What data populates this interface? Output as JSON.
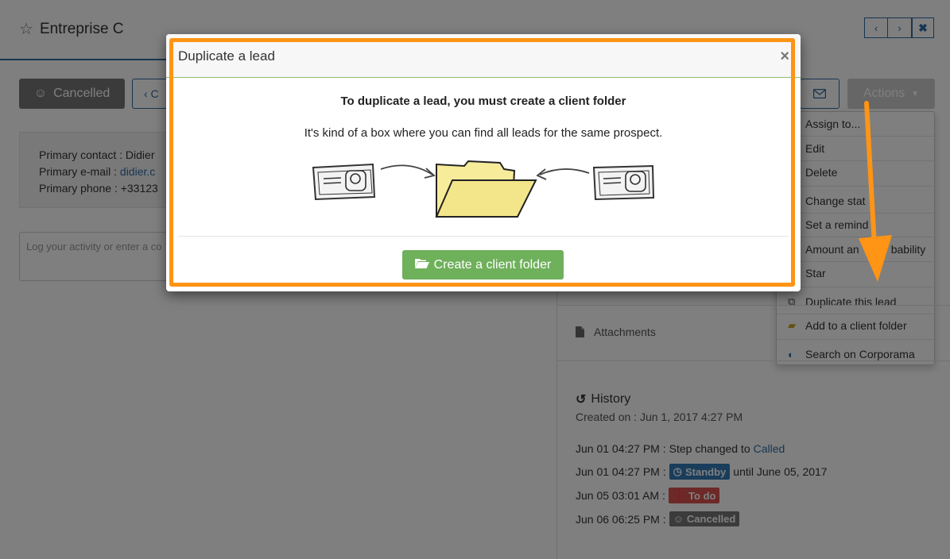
{
  "header": {
    "title": "Entreprise C",
    "prev_icon": "‹",
    "next_icon": "›",
    "close_icon": "✖"
  },
  "toolbar": {
    "status_label": "Cancelled",
    "back_label": "‹ C",
    "actions_label": "Actions"
  },
  "contact": {
    "primary_contact_label": "Primary contact : ",
    "primary_contact_value": "Didier",
    "primary_email_label": "Primary e-mail : ",
    "primary_email_value": "didier.c",
    "primary_phone_label": "Primary phone : ",
    "primary_phone_value": "+33123"
  },
  "activity": {
    "placeholder": "Log your activity or enter a co"
  },
  "actions_menu": {
    "items": [
      {
        "label": "Assign to..."
      },
      {
        "label": "Edit"
      },
      {
        "label": "Delete"
      },
      {
        "label": "Change stat"
      },
      {
        "label": "Set a remind"
      },
      {
        "label": "Amount an"
      },
      {
        "label": "Star"
      },
      {
        "label": "Duplicate this lead"
      },
      {
        "label": "Add to a client folder"
      },
      {
        "label": "Search on Corporama"
      }
    ],
    "amount_suffix": "bability"
  },
  "side": {
    "attachments_label": "Attachments",
    "history_title": "History",
    "created_on": "Created on : Jun 1, 2017 4:27 PM",
    "history": [
      {
        "time": "Jun 01 04:27 PM :",
        "text": "Step changed to",
        "link": "Called"
      },
      {
        "time": "Jun 01 04:27 PM :",
        "badge": "Standby",
        "after": "until June 05, 2017"
      },
      {
        "time": "Jun 05 03:01 AM :",
        "badge": "To do"
      },
      {
        "time": "Jun 06 06:25 PM :",
        "badge": "Cancelled"
      }
    ]
  },
  "modal": {
    "title": "Duplicate a lead",
    "close": "×",
    "heading": "To duplicate a lead, you must create a client folder",
    "subtitle": "It's kind of a box where you can find all leads for the same prospect.",
    "button_label": "Create a client folder"
  },
  "colors": {
    "highlight": "#ff9415",
    "primary": "#2e6da4",
    "success": "#6fb05b",
    "arrow": "#ff9415"
  }
}
